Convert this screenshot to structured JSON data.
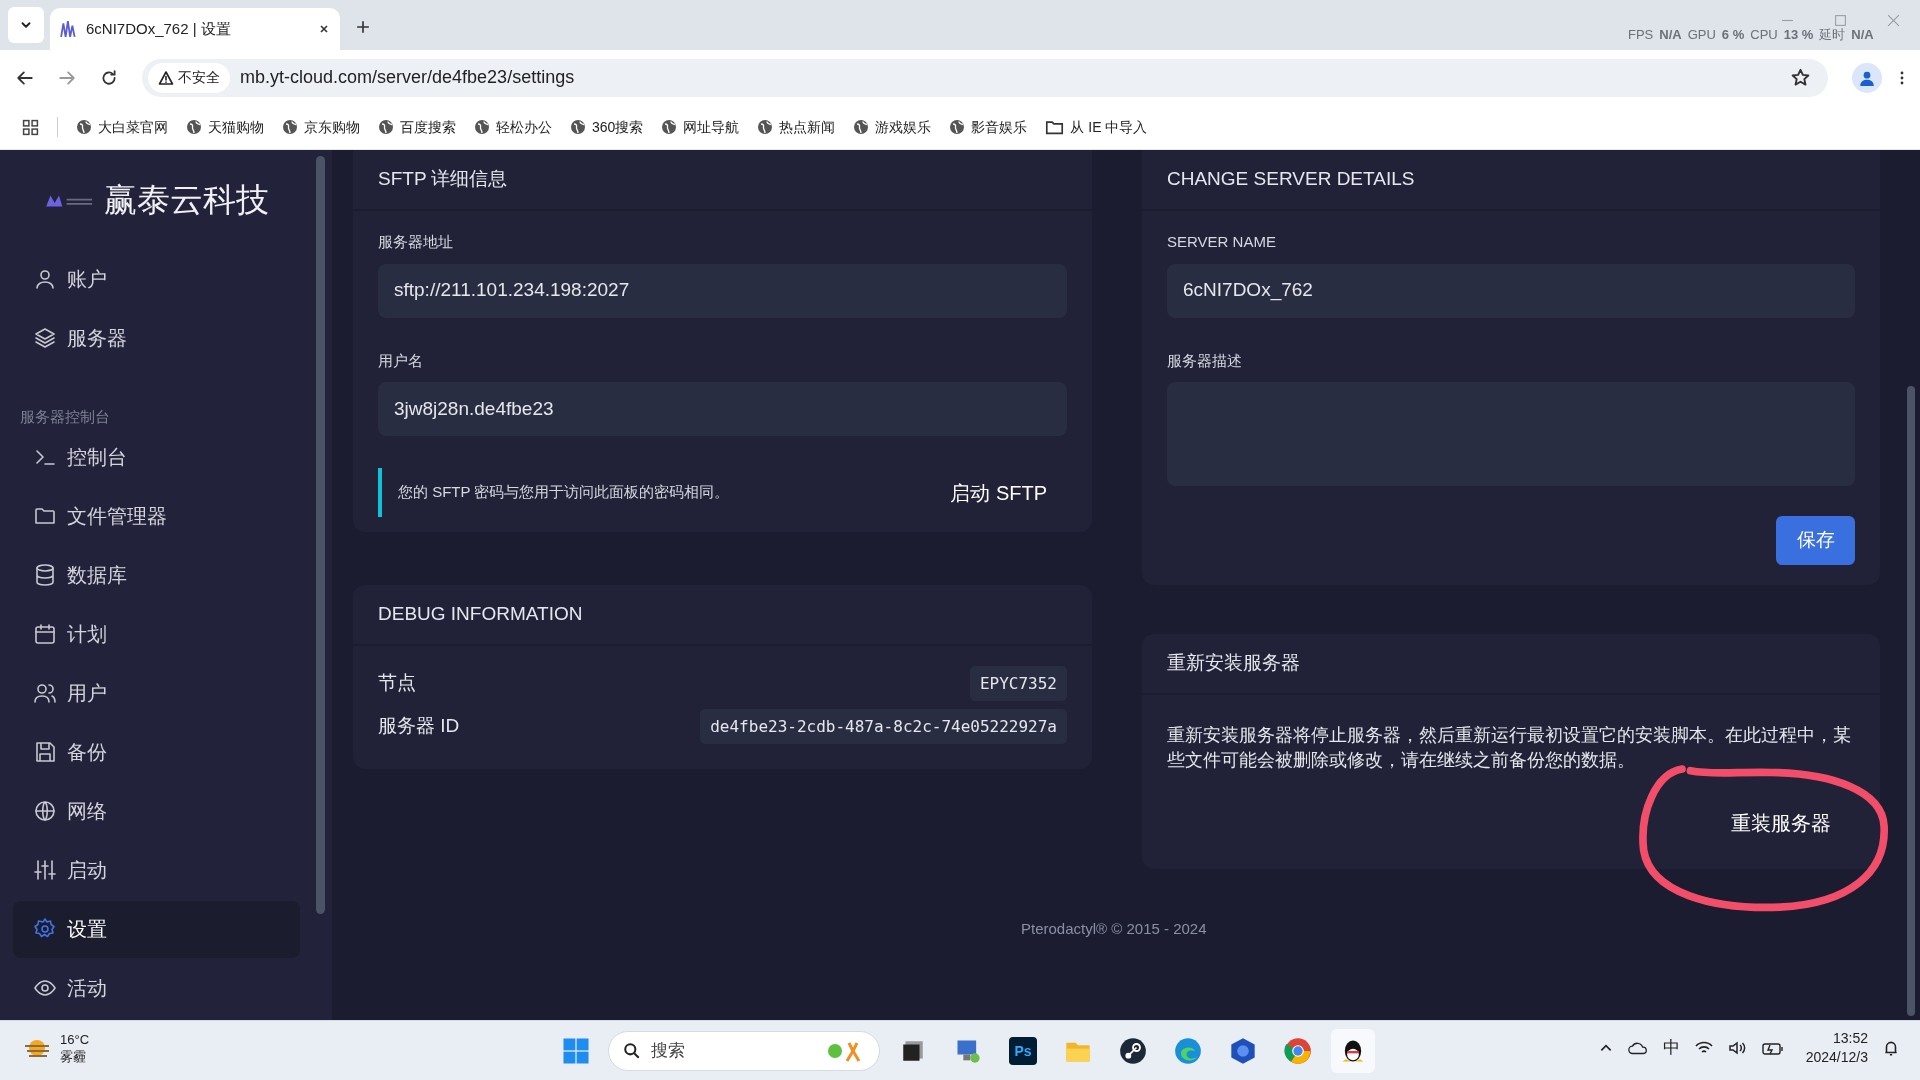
{
  "browser": {
    "tab_title": "6cNI7DOx_762 | 设置",
    "security": "不安全",
    "url": "mb.yt-cloud.com/server/de4fbe23/settings",
    "overlay": [
      {
        "label": "FPS",
        "value": "N/A"
      },
      {
        "label": "GPU",
        "value": "6 %"
      },
      {
        "label": "CPU",
        "value": "13 %"
      },
      {
        "label": "延时",
        "value": "N/A"
      }
    ],
    "bookmarks": [
      {
        "label": "大白菜官网",
        "kind": "site"
      },
      {
        "label": "天猫购物",
        "kind": "site"
      },
      {
        "label": "京东购物",
        "kind": "site"
      },
      {
        "label": "百度搜索",
        "kind": "site"
      },
      {
        "label": "轻松办公",
        "kind": "site"
      },
      {
        "label": "360搜索",
        "kind": "site"
      },
      {
        "label": "网址导航",
        "kind": "site"
      },
      {
        "label": "热点新闻",
        "kind": "site"
      },
      {
        "label": "游戏娱乐",
        "kind": "site"
      },
      {
        "label": "影音娱乐",
        "kind": "site"
      },
      {
        "label": "从 IE 中导入",
        "kind": "folder"
      }
    ]
  },
  "sidebar": {
    "brand": "赢泰云科技",
    "top_items": [
      {
        "label": "账户",
        "selected": false
      },
      {
        "label": "服务器",
        "selected": false
      }
    ],
    "section_label": "服务器控制台",
    "items": [
      {
        "label": "控制台",
        "selected": false
      },
      {
        "label": "文件管理器",
        "selected": false
      },
      {
        "label": "数据库",
        "selected": false
      },
      {
        "label": "计划",
        "selected": false
      },
      {
        "label": "用户",
        "selected": false
      },
      {
        "label": "备份",
        "selected": false
      },
      {
        "label": "网络",
        "selected": false
      },
      {
        "label": "启动",
        "selected": false
      },
      {
        "label": "设置",
        "selected": true
      },
      {
        "label": "活动",
        "selected": false
      }
    ]
  },
  "sftp": {
    "title": "SFTP 详细信息",
    "address_label": "服务器地址",
    "address": "sftp://211.101.234.198:2027",
    "username_label": "用户名",
    "username": "3jw8j28n.de4fbe23",
    "note": "您的 SFTP 密码与您用于访问此面板的密码相同。",
    "launch_button": "启动 SFTP"
  },
  "debug": {
    "title": "DEBUG INFORMATION",
    "rows": [
      {
        "label": "节点",
        "value": "EPYC7352"
      },
      {
        "label": "服务器 ID",
        "value": "de4fbe23-2cdb-487a-8c2c-74e05222927a"
      }
    ]
  },
  "details": {
    "title": "CHANGE SERVER DETAILS",
    "name_label": "SERVER NAME",
    "name": "6cNI7DOx_762",
    "description_label": "服务器描述",
    "save_button": "保存"
  },
  "reinstall": {
    "title": "重新安装服务器",
    "text": "重新安装服务器将停止服务器，然后重新运行最初设置它的安装脚本。在此过程中，某些文件可能会被删除或修改，请在继续之前备份您的数据。",
    "button": "重装服务器"
  },
  "footer": "Pterodactyl® © 2015 - 2024",
  "taskbar": {
    "temperature": "16°C",
    "weather": "雾霾",
    "search_placeholder": "搜索",
    "ps_label": "Ps",
    "input_method": "中",
    "time": "13:52",
    "date": "2024/12/3"
  }
}
